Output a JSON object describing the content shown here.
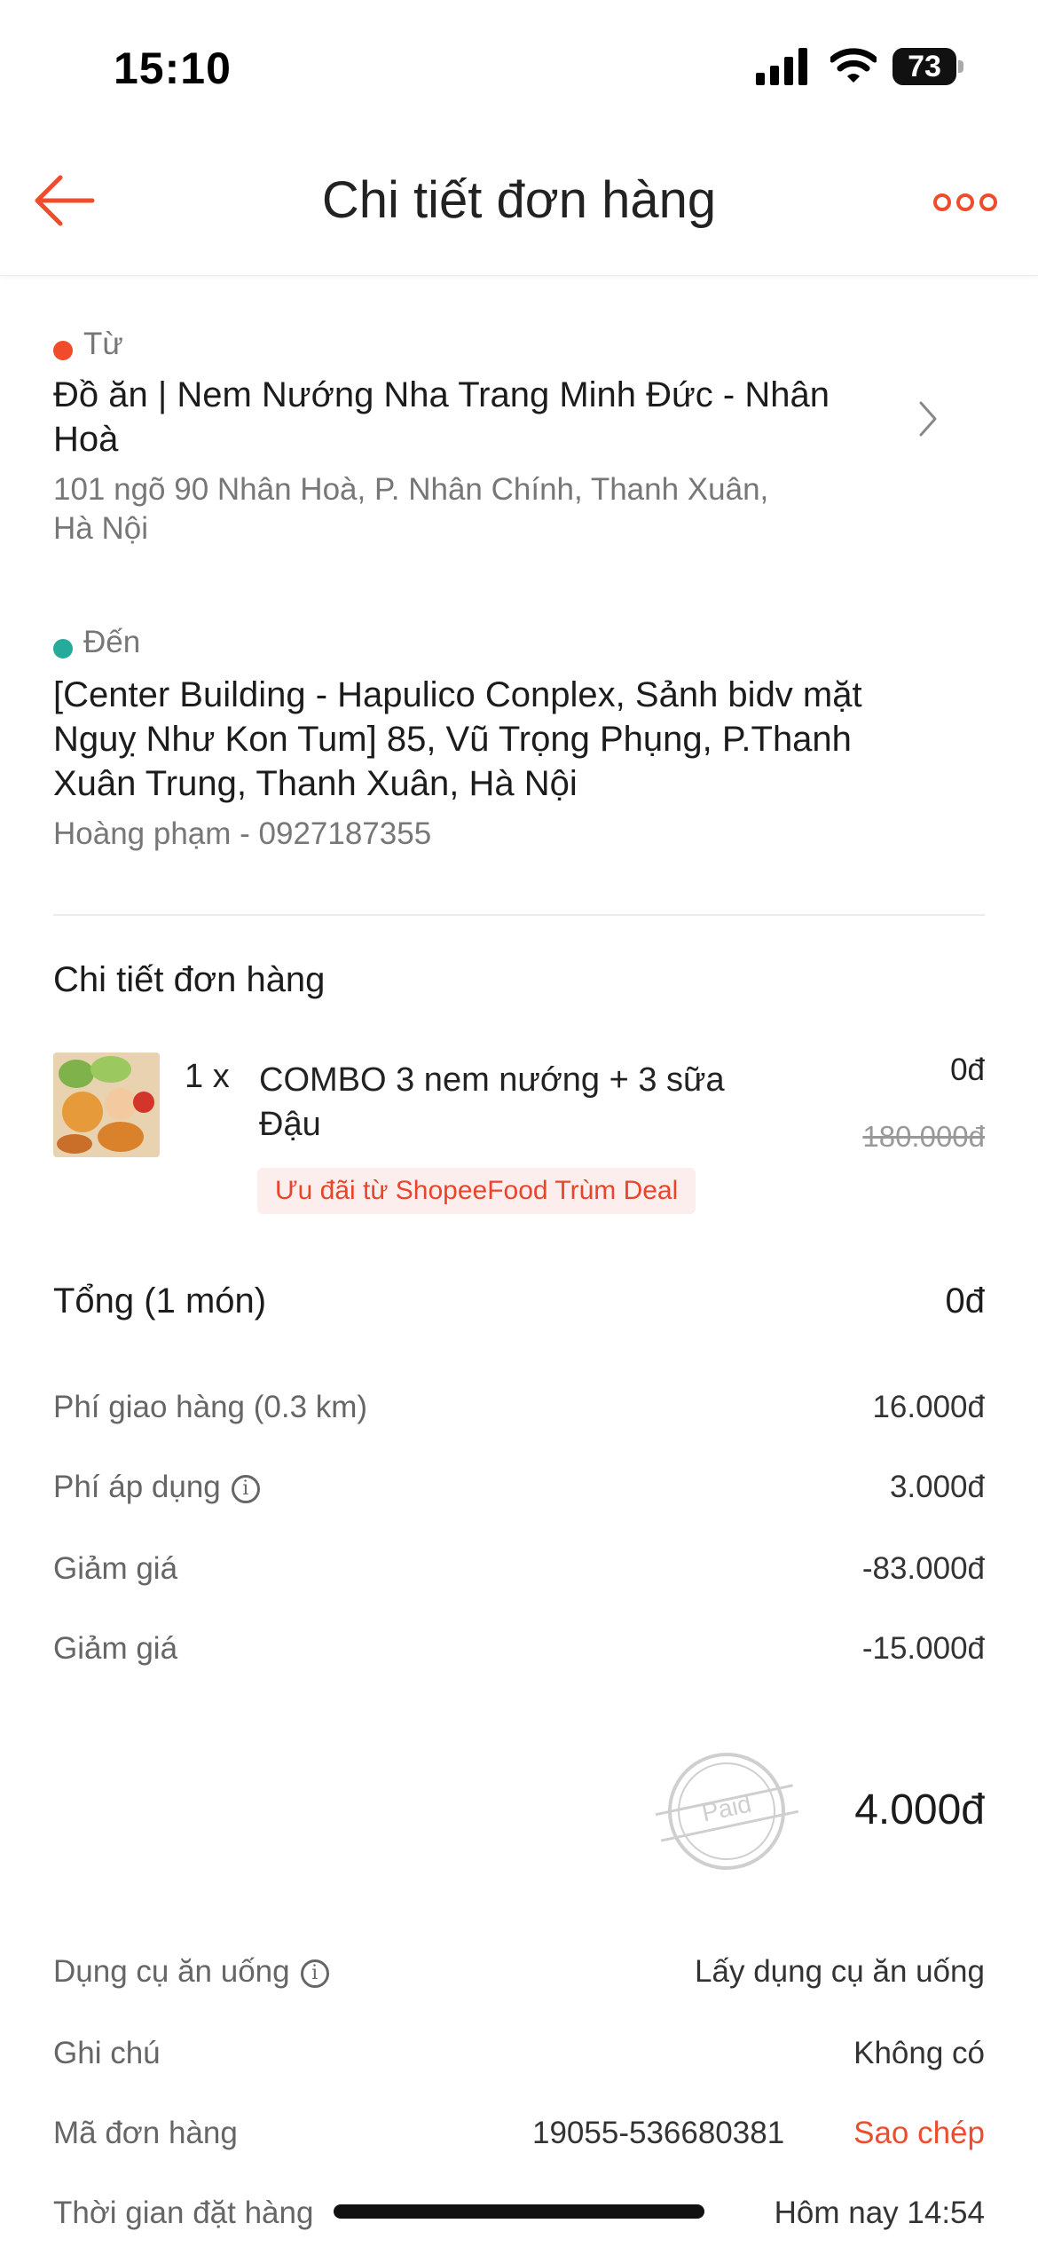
{
  "status_bar": {
    "time": "15:10",
    "battery": "73"
  },
  "header": {
    "title": "Chi tiết đơn hàng"
  },
  "from": {
    "label": "Từ",
    "name_line1": "Đồ ăn | Nem Nướng Nha Trang Minh Đức - Nhân",
    "name_line2": "Hoà",
    "address_line1": "101 ngõ 90 Nhân Hoà, P. Nhân Chính, Thanh Xuân,",
    "address_line2": "Hà Nội"
  },
  "to": {
    "label": "Đến",
    "address_line1": "[Center Building - Hapulico Conplex, Sảnh bidv mặt",
    "address_line2": "Nguỵ Như Kon Tum] 85, Vũ Trọng Phụng, P.Thanh",
    "address_line3": "Xuân Trung, Thanh Xuân, Hà Nội",
    "contact": "Hoàng phạm - 0927187355"
  },
  "order": {
    "section_title": "Chi tiết đơn hàng",
    "item": {
      "qty": "1 x",
      "name_line1": "COMBO 3 nem nướng + 3 sữa",
      "name_line2": "Đậu",
      "price": "0đ",
      "original_price": "180.000đ",
      "promo": "Ưu đãi từ ShopeeFood Trùm Deal"
    }
  },
  "summary": {
    "total_label": "Tổng (1 món)",
    "total_value": "0đ",
    "rows": [
      {
        "label": "Phí giao hàng (0.3 km)",
        "value": "16.000đ"
      },
      {
        "label": "Phí áp dụng",
        "value": "3.000đ"
      },
      {
        "label": "Giảm giá",
        "value": "-83.000đ"
      },
      {
        "label": "Giảm giá",
        "value": "-15.000đ"
      }
    ],
    "paid_stamp": "Paid",
    "grand_total": "4.000đ"
  },
  "details": {
    "utensils_label": "Dụng cụ ăn uống",
    "utensils_value": "Lấy dụng cụ ăn uống",
    "note_label": "Ghi chú",
    "note_value": "Không có",
    "order_id_label": "Mã đơn hàng",
    "order_id_value": "19055-536680381",
    "copy_label": "Sao chép",
    "order_time_label": "Thời gian đặt hàng",
    "order_time_value": "Hôm nay 14:54"
  },
  "colors": {
    "accent": "#ee4d2d",
    "from_dot": "#f04b2b",
    "to_dot": "#26aa99"
  },
  "icons": [
    "back-arrow-icon",
    "more-icon",
    "chevron-right-icon",
    "info-icon",
    "paid-stamp-icon",
    "signal-icon",
    "wifi-icon",
    "battery-icon"
  ]
}
